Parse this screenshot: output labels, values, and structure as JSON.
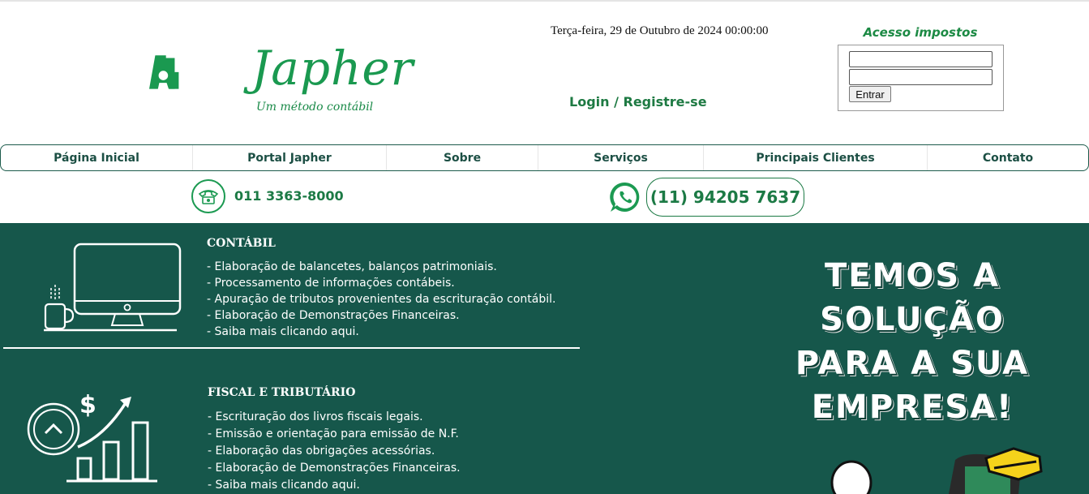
{
  "brand": {
    "name": "Japher",
    "tagline": "Um método contábil",
    "colors": {
      "primary": "#1a9950",
      "dark": "#16574b"
    }
  },
  "header": {
    "date_time": "Terça-feira, 29 de Outubro de 2024 00:00:00",
    "login_link": "Login / Registre-se"
  },
  "access_box": {
    "title": "Acesso impostos",
    "field1_value": "",
    "field2_value": "",
    "submit_label": "Entrar"
  },
  "nav": {
    "items": [
      "Página Inicial",
      "Portal Japher",
      "Sobre",
      "Serviços",
      "Principais Clientes",
      "Contato"
    ]
  },
  "contact": {
    "phone": "011 3363-8000",
    "whatsapp": "(11) 94205 7637",
    "icons": [
      "telephone-icon",
      "whatsapp-icon"
    ]
  },
  "services": {
    "contabil": {
      "title": "CONTÁBIL",
      "items": [
        "- Elaboração de balancetes, balanços patrimoniais.",
        "- Processamento de informações contábeis.",
        "- Apuração de tributos provenientes da escrituração contábil.",
        "- Elaboração de Demonstrações Financeiras.",
        "- Saiba mais clicando aqui."
      ]
    },
    "fiscal": {
      "title": "FISCAL E TRIBUTÁRIO",
      "items": [
        "- Escrituração dos livros fiscais legais.",
        "- Emissão e orientação para emissão de N.F.",
        "- Elaboração das obrigações acessórias.",
        "- Elaboração de Demonstrações Financeiras.",
        "- Saiba mais clicando aqui."
      ]
    }
  },
  "promo": {
    "lines": [
      "TEMOS A",
      "SOLUÇÃO",
      "PARA A SUA",
      "EMPRESA!"
    ]
  }
}
